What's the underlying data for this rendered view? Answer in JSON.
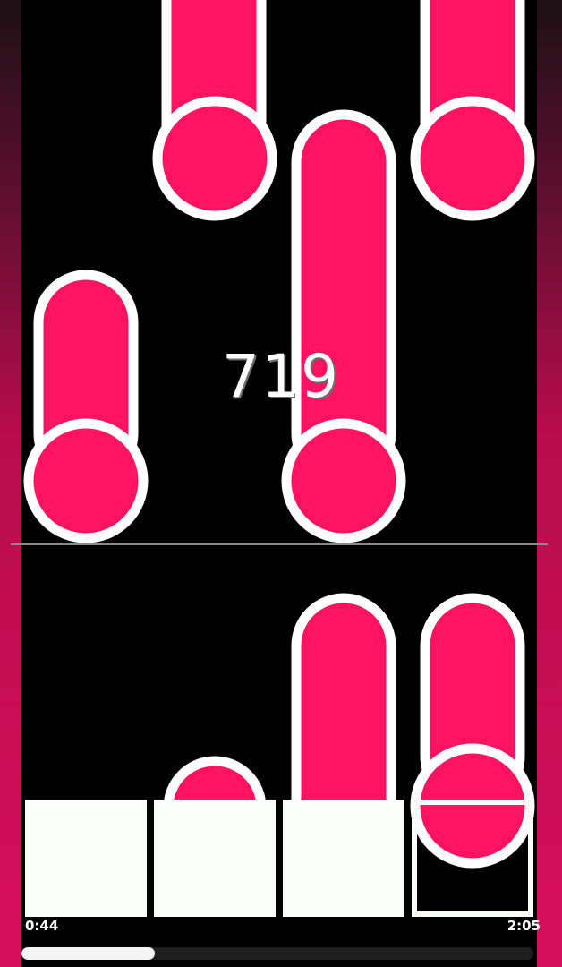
{
  "game": {
    "score": "719",
    "note_color": "#fe1362",
    "outline_color": "#ffffff",
    "side_color": "#d60f5c",
    "key_color": "#fbfdf9",
    "lanes": 4
  },
  "playback": {
    "elapsed": "0:44",
    "total": "2:05",
    "progress_fraction": 0.26
  }
}
